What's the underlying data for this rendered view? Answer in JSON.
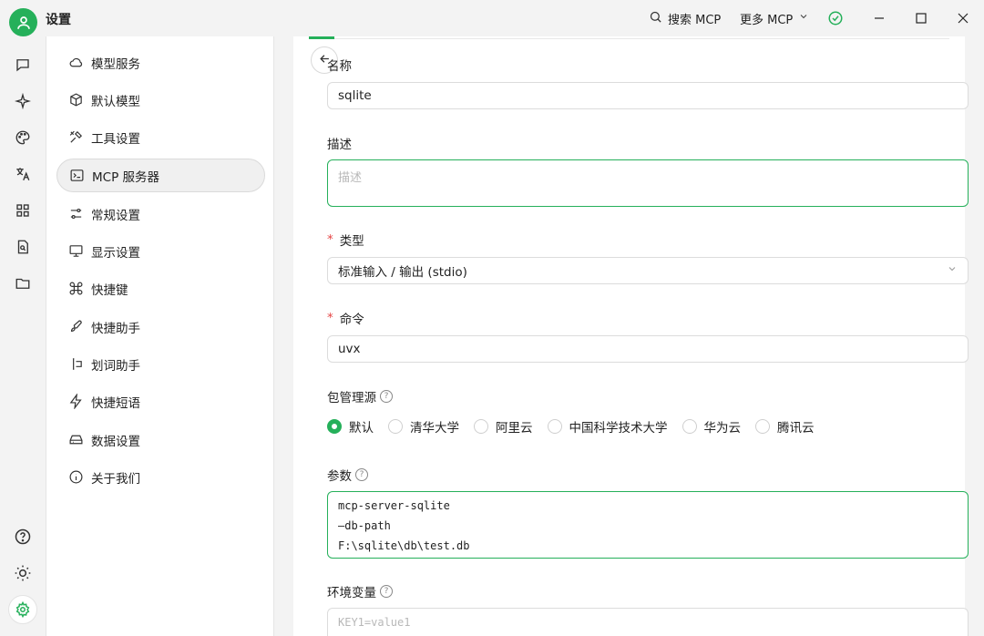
{
  "app": {
    "title": "设置"
  },
  "titlebar": {
    "search_mcp": "搜索 MCP",
    "more_mcp": "更多 MCP"
  },
  "menu": {
    "items": [
      {
        "label": "模型服务",
        "icon": "cloud-icon"
      },
      {
        "label": "默认模型",
        "icon": "cube-icon"
      },
      {
        "label": "工具设置",
        "icon": "tools-icon"
      },
      {
        "label": "MCP 服务器",
        "icon": "terminal-icon",
        "active": true
      },
      {
        "label": "常规设置",
        "icon": "sliders-icon"
      },
      {
        "label": "显示设置",
        "icon": "monitor-icon"
      },
      {
        "label": "快捷键",
        "icon": "command-icon"
      },
      {
        "label": "快捷助手",
        "icon": "rocket-icon"
      },
      {
        "label": "划词助手",
        "icon": "text-select-icon"
      },
      {
        "label": "快捷短语",
        "icon": "zap-icon"
      },
      {
        "label": "数据设置",
        "icon": "hard-drive-icon"
      },
      {
        "label": "关于我们",
        "icon": "info-icon"
      }
    ]
  },
  "form": {
    "name_label": "名称",
    "name_value": "sqlite",
    "desc_label": "描述",
    "desc_placeholder": "描述",
    "type_label": "类型",
    "type_value": "标准输入 / 输出 (stdio)",
    "command_label": "命令",
    "command_value": "uvx",
    "registry_label": "包管理源",
    "registry_options": [
      "默认",
      "清华大学",
      "阿里云",
      "中国科学技术大学",
      "华为云",
      "腾讯云"
    ],
    "registry_selected": "默认",
    "args_label": "参数",
    "args_lines": [
      "mcp-server-sqlite",
      "—db-path",
      "F:\\sqlite\\db\\test.db"
    ],
    "env_label": "环境变量",
    "env_placeholder": "KEY1=value1"
  },
  "colors": {
    "accent": "#25b05a",
    "required": "#e54545"
  }
}
